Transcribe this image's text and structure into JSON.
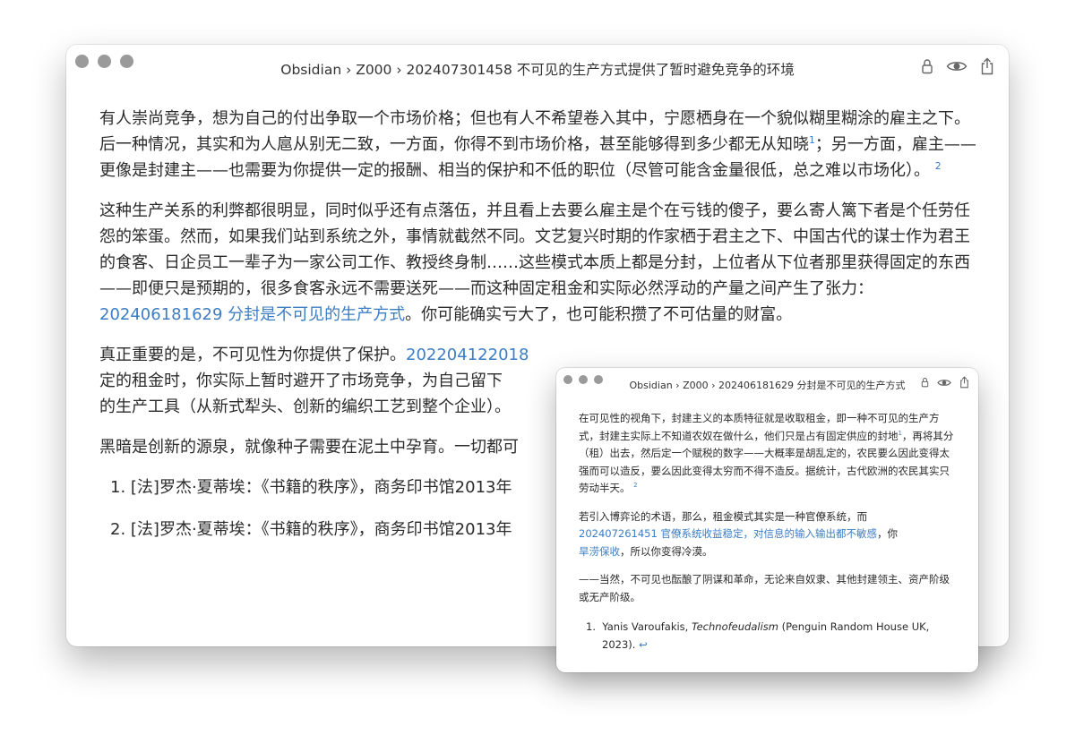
{
  "main_window": {
    "breadcrumb": "Obsidian › Z000 › 202407301458 不可见的生产方式提供了暂时避免竞争的环境",
    "icons": [
      "lock-icon",
      "eye-icon",
      "share-icon"
    ],
    "p1": {
      "a": "有人崇尚竞争，想为自己的付出争取一个市场价格；但也有人不希望卷入其中，宁愿栖身在一个貌似糊里糊涂的雇主之下。后一种情况，其实和为人扈从别无二致，一方面，你得不到市场价格，甚至能够得到多少都无从知晓",
      "fn1": "1",
      "b": "；另一方面，雇主——更像是封建主——也需要为你提供一定的报酬、相当的保护和不低的职位（尽管可能含金量很低，总之难以市场化）。",
      "fn2": "2"
    },
    "p2": {
      "a": "这种生产关系的利弊都很明显，同时似乎还有点落伍，并且看上去要么雇主是个在亏钱的傻子，要么寄人篱下者是个任劳任怨的笨蛋。然而，如果我们站到系统之外，事情就截然不同。文艺复兴时期的作家栖于君主之下、中国古代的谋士作为君王的食客、日企员工一辈子为一家公司工作、教授终身制……这些模式本质上都是分封，上位者从下位者那里获得固定的东西——即便只是预期的，很多食客永远不需要送死——而这种固定租金和实际必然浮动的产量之间产生了张力：",
      "link": "202406181629 分封是不可见的生产方式",
      "b": "。你可能确实亏大了，也可能积攒了不可估量的财富。"
    },
    "p3": {
      "a": "真正重要的是，不可见性为你提供了保护。",
      "link": "202204122018",
      "b": "定的租金时，你实际上暂时避开了市场竞争，为自己留下",
      "c": "的生产工具（从新式犁头、创新的编织工艺到整个企业）。"
    },
    "p4": "黑暗是创新的源泉，就像种子需要在泥土中孕育。一切都可",
    "footnotes": [
      "1.  [法]罗杰·夏蒂埃：《书籍的秩序》，商务印书馆2013年",
      "2.  [法]罗杰·夏蒂埃：《书籍的秩序》，商务印书馆2013年"
    ]
  },
  "popover_window": {
    "breadcrumb": "Obsidian › Z000 › 202406181629 分封是不可见的生产方式",
    "icons": [
      "lock-icon",
      "eye-icon",
      "share-icon"
    ],
    "p1": {
      "a": "在可见性的视角下，封建主义的本质特征就是收取租金，即一种不可见的生产方式，封建主实际上不知道农奴在做什么，他们只是占有固定供应的封地",
      "fn1": "1",
      "b": "，再将其分（租）出去，然后定一个赋税的数字——大概率是胡乱定的，农民要么因此变得太强而可以造反，要么因此变得太穷而不得不造反。据统计，古代欧洲的农民其实只劳动半天。",
      "fn2": "2"
    },
    "p2": {
      "a": "若引入博弈论的术语，那么，租金模式其实是一种官僚系统，而",
      "link1": "202407261451 官僚系统收益稳定，对信息的输入输出都不敏感",
      "b": "，你",
      "link2": "旱涝保收",
      "c": "，所以你变得冷漠。"
    },
    "p3": "——当然，不可见也酝酿了阴谋和革命，无论来自奴隶、其他封建领主、资产阶级或无产阶级。",
    "footnote": {
      "num": "1.",
      "author": "Yanis Varoufakis,",
      "title": "Technofeudalism",
      "rest": "(Penguin Random House UK, 2023).",
      "return": "↩"
    }
  },
  "colors": {
    "link": "#3d7dc3",
    "text": "#2b2b2b",
    "dots": "#9a9a9a"
  }
}
